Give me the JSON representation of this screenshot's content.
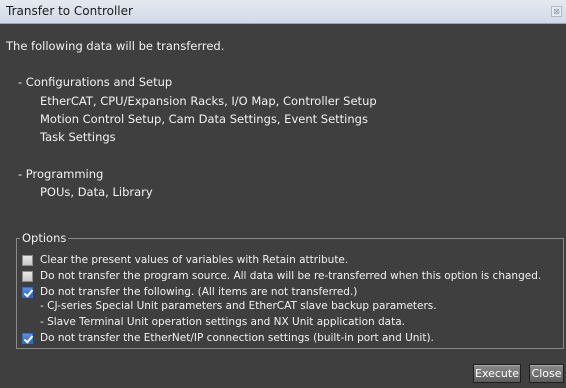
{
  "window": {
    "title": "Transfer to Controller",
    "close_glyph": "⊠"
  },
  "intro": "The following data will be transferred.",
  "sections": [
    {
      "heading": "- Configurations and Setup",
      "items": [
        "EtherCAT, CPU/Expansion Racks, I/O Map, Controller Setup",
        "Motion Control Setup, Cam Data Settings, Event Settings",
        "Task Settings"
      ]
    },
    {
      "heading": "- Programming",
      "items": [
        "POUs, Data, Library"
      ]
    }
  ],
  "options": {
    "legend": "Options",
    "clear_retain": {
      "label": "Clear the present values of variables with Retain attribute.",
      "checked": false
    },
    "no_program_source": {
      "label": "Do not transfer the program source. All data will be re-transferred when this option is changed.",
      "checked": false
    },
    "no_following": {
      "label": "Do not transfer the following. (All items are not transferred.)",
      "checked": true,
      "sub": [
        "- CJ-series Special Unit parameters and EtherCAT slave backup parameters.",
        "- Slave Terminal Unit operation settings and NX Unit application data."
      ]
    },
    "no_ethernetip": {
      "label": "Do not transfer the EtherNet/IP connection settings (built-in port and Unit).",
      "checked": true
    }
  },
  "buttons": {
    "execute": "Execute",
    "close": "Close"
  }
}
